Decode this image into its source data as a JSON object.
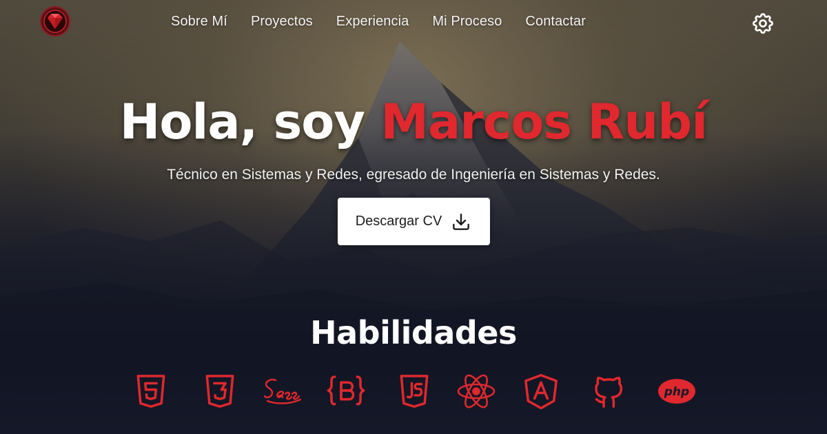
{
  "nav": {
    "items": [
      {
        "label": "Sobre Mí"
      },
      {
        "label": "Proyectos"
      },
      {
        "label": "Experiencia"
      },
      {
        "label": "Mi Proceso"
      },
      {
        "label": "Contactar"
      }
    ]
  },
  "hero": {
    "greeting": "Hola, soy ",
    "name": "Marcos Rubí",
    "subtitle": "Técnico en Sistemas y Redes, egresado de Ingeniería en Sistemas y Redes.",
    "cv_button_label": "Descargar CV"
  },
  "skills": {
    "title": "Habilidades",
    "icons": [
      "html5-icon",
      "css3-icon",
      "sass-icon",
      "bootstrap-icon",
      "javascript-icon",
      "react-icon",
      "angular-icon",
      "github-icon",
      "php-icon"
    ]
  },
  "colors": {
    "accent": "#e0282e",
    "button_bg": "#ffffff",
    "text": "#ffffff"
  }
}
